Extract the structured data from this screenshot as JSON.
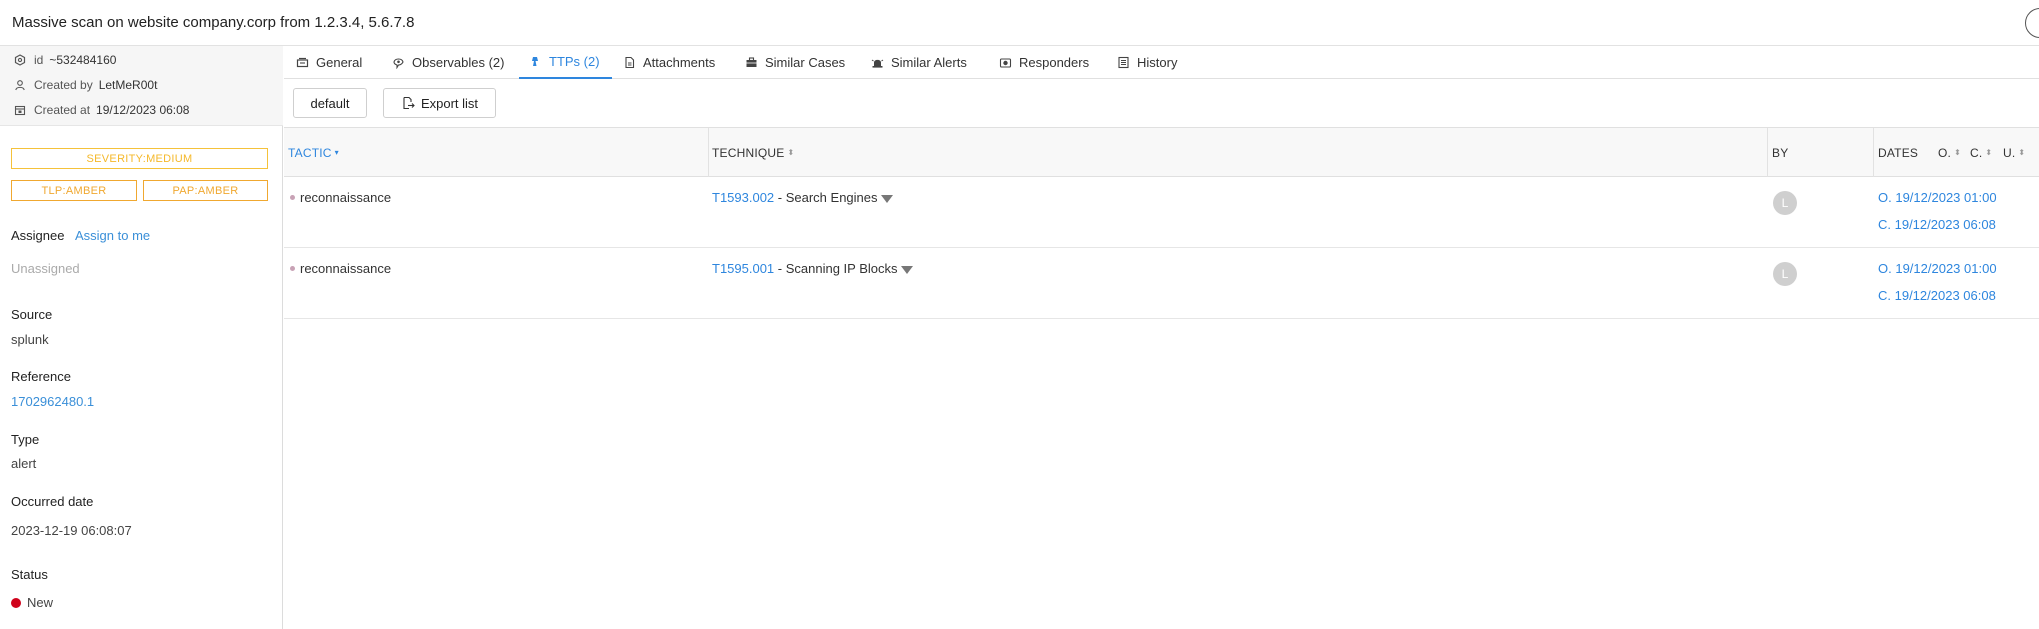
{
  "header": {
    "title": "Massive scan on website company.corp from 1.2.3.4, 5.6.7.8"
  },
  "meta": {
    "id_label": "id",
    "id_value": "~532484160",
    "created_by_label": "Created by",
    "created_by_value": "LetMeR00t",
    "created_at_label": "Created at",
    "created_at_value": "19/12/2023 06:08"
  },
  "tags": {
    "severity": "SEVERITY:MEDIUM",
    "tlp": "TLP:AMBER",
    "pap": "PAP:AMBER"
  },
  "fields": {
    "assignee_label": "Assignee",
    "assign_to_me": "Assign to me",
    "assignee_value": "Unassigned",
    "source_label": "Source",
    "source_value": "splunk",
    "reference_label": "Reference",
    "reference_value": "1702962480.1",
    "type_label": "Type",
    "type_value": "alert",
    "occurred_label": "Occurred date",
    "occurred_value": "2023-12-19 06:08:07",
    "status_label": "Status",
    "status_value": "New"
  },
  "tabs": [
    {
      "label": "General",
      "icon": "general-icon"
    },
    {
      "label": "Observables (2)",
      "icon": "observables-icon"
    },
    {
      "label": "TTPs (2)",
      "icon": "ttps-icon",
      "active": true
    },
    {
      "label": "Attachments",
      "icon": "attachment-icon"
    },
    {
      "label": "Similar Cases",
      "icon": "briefcase-icon"
    },
    {
      "label": "Similar Alerts",
      "icon": "alert-icon"
    },
    {
      "label": "Responders",
      "icon": "responders-icon"
    },
    {
      "label": "History",
      "icon": "history-icon"
    }
  ],
  "toolbar": {
    "default_label": "default",
    "export_label": "Export list"
  },
  "table": {
    "headers": {
      "tactic": "TACTIC",
      "technique": "TECHNIQUE",
      "by": "BY",
      "dates": "DATES",
      "o": "O.",
      "c": "C.",
      "u": "U."
    },
    "rows": [
      {
        "tactic": "reconnaissance",
        "tech_id": "T1593.002",
        "tech_name": " - Search Engines",
        "by": "L",
        "occurred": "O. 19/12/2023 01:00",
        "created": "C. 19/12/2023 06:08"
      },
      {
        "tactic": "reconnaissance",
        "tech_id": "T1595.001",
        "tech_name": " - Scanning IP Blocks",
        "by": "L",
        "occurred": "O. 19/12/2023 01:00",
        "created": "C. 19/12/2023 06:08"
      }
    ]
  },
  "colors": {
    "accent": "#2e86de",
    "amber": "#f0a830",
    "status_new": "#d0021b"
  }
}
